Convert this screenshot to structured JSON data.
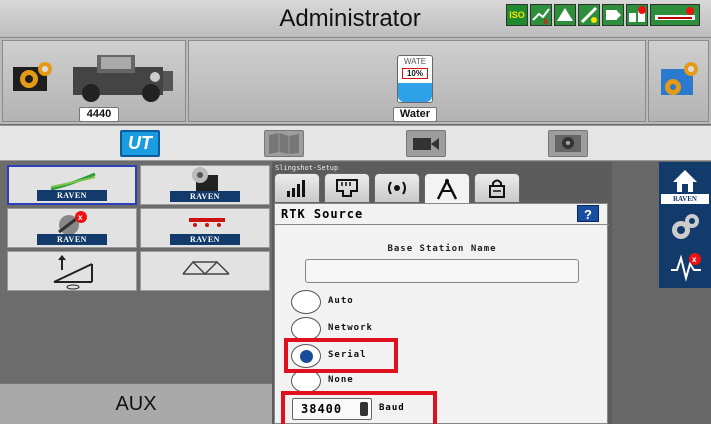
{
  "header": {
    "title": "Administrator",
    "status_icons": [
      {
        "name": "iso-status-icon",
        "label": "ISO",
        "bg": "#1f8a2e"
      },
      {
        "name": "section-status-icon",
        "label": "",
        "bg": "#2d8f3c"
      },
      {
        "name": "guidance-status-icon",
        "label": "",
        "bg": "#2d8f3c"
      },
      {
        "name": "gps-status-icon",
        "label": "",
        "bg": "#2d8f3c"
      },
      {
        "name": "display-status-icon",
        "label": "",
        "bg": "#2d8f3c"
      },
      {
        "name": "alarm-status-icon",
        "label": "",
        "bg": "#2d8f3c"
      },
      {
        "name": "implement-status-icon",
        "label": "",
        "bg": "#2d8f3c"
      }
    ]
  },
  "machine": {
    "vehicle_label": "4440",
    "tank_label": "Water",
    "tank_short": "WATE",
    "tank_percent": "10%",
    "tank_fill": 0.1
  },
  "main_tabs": [
    {
      "name": "tab-ut",
      "label": "UT",
      "active": true
    },
    {
      "name": "tab-map",
      "label": "",
      "active": false
    },
    {
      "name": "tab-camera",
      "label": "",
      "active": false
    },
    {
      "name": "tab-settings",
      "label": "",
      "active": false
    }
  ],
  "left_grid": {
    "cells": [
      {
        "name": "app-raven-slingshot",
        "brand": "RAVEN"
      },
      {
        "name": "app-raven-sprayer",
        "brand": "RAVEN"
      },
      {
        "name": "app-raven-guidance",
        "brand": "RAVEN"
      },
      {
        "name": "app-raven-boom",
        "brand": "RAVEN"
      },
      {
        "name": "app-height-control",
        "brand": ""
      },
      {
        "name": "app-boom-frame",
        "brand": ""
      }
    ],
    "aux_label": "AUX"
  },
  "settings": {
    "section_label": "Slingshot-Setup",
    "rtk_title": "RTK Source",
    "help_label": "?",
    "base_station_label": "Base Station Name",
    "base_station_value": "",
    "options": [
      "Auto",
      "Network",
      "Serial",
      "None"
    ],
    "selected_option": "Serial",
    "baud_value": "38400",
    "baud_unit": "Baud"
  },
  "right_nav": {
    "brand": "RAVEN"
  },
  "colors": {
    "accent_blue": "#1a4c9c",
    "raven_navy": "#123a6a",
    "highlight_red": "#e0101e"
  }
}
